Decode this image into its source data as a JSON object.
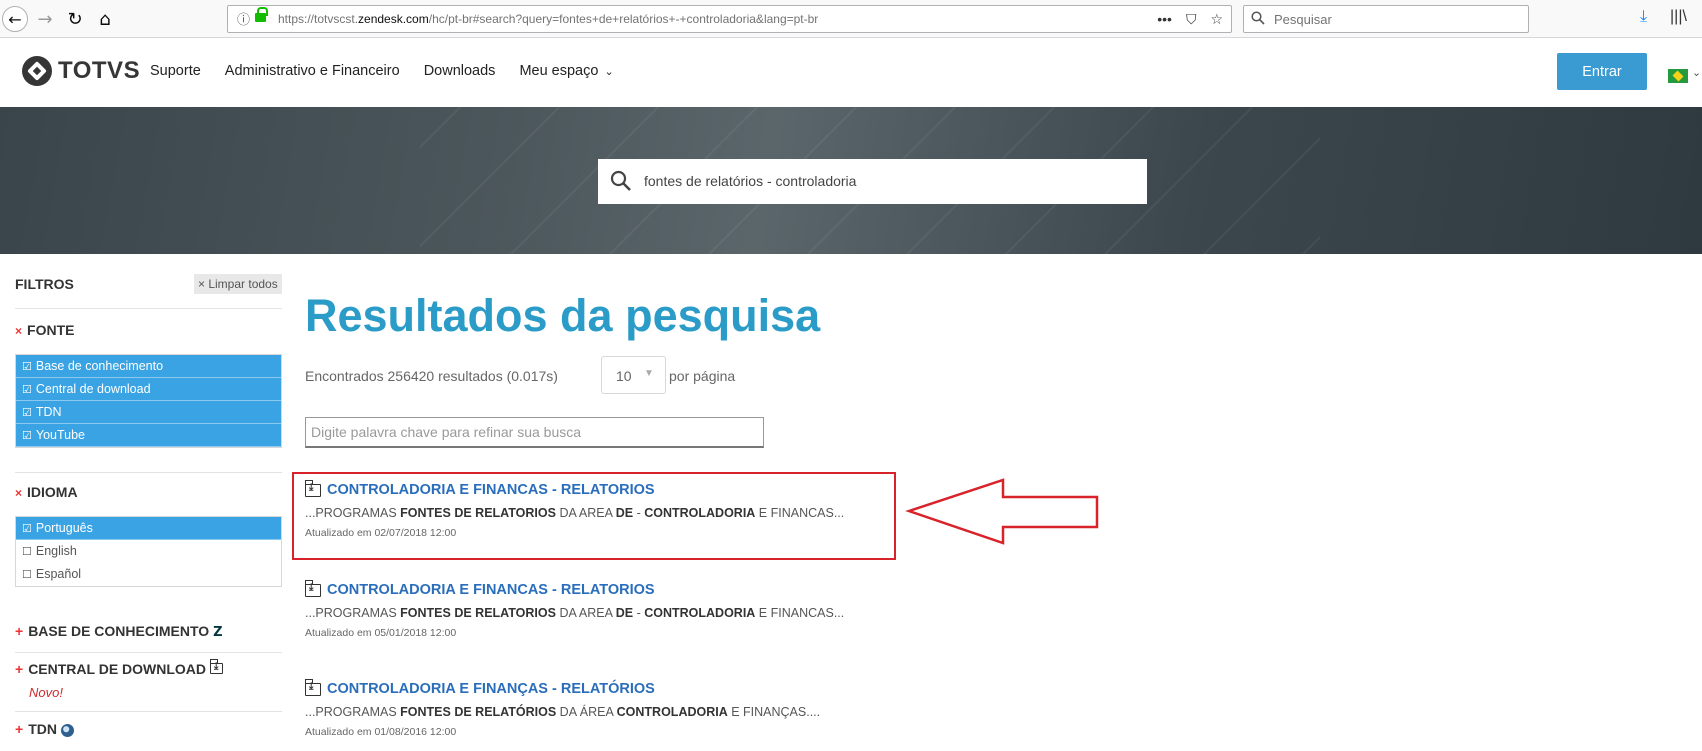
{
  "browser": {
    "url_prefix": "https://totvscst.",
    "url_domain": "zendesk.com",
    "url_suffix": "/hc/pt-br#search?query=fontes+de+relatórios+-+controladoria&lang=pt-br",
    "search_placeholder": "Pesquisar"
  },
  "header": {
    "logo_text": "TOTVS",
    "nav": [
      "Suporte",
      "Administrativo e Financeiro",
      "Downloads",
      "Meu espaço"
    ],
    "login_label": "Entrar"
  },
  "hero": {
    "query": "fontes de relatórios - controladoria"
  },
  "sidebar": {
    "title": "FILTROS",
    "clear_all": "× Limpar todos",
    "fonte": {
      "title": "FONTE",
      "items": [
        "Base de conhecimento",
        "Central de download",
        "TDN",
        "YouTube"
      ]
    },
    "idioma": {
      "title": "IDIOMA",
      "items": [
        "Português",
        "English",
        "Español"
      ]
    },
    "collapsed": [
      "BASE DE CONHECIMENTO",
      "CENTRAL DE DOWNLOAD",
      "TDN"
    ],
    "novo": "Novo!"
  },
  "main": {
    "title": "Resultados da pesquisa",
    "count": "Encontrados 256420 resultados (0.017s)",
    "per_page_value": "10",
    "per_page_label": "por página",
    "refine_placeholder": "Digite palavra chave para refinar sua busca",
    "results": [
      {
        "title": "CONTROLADORIA E FINANCAS - RELATORIOS",
        "snippet": [
          "...PROGRAMAS ",
          "FONTES DE RELATORIOS",
          " DA AREA ",
          "DE",
          " - ",
          "CONTROLADORIA",
          " E FINANCAS..."
        ],
        "date": "Atualizado em 02/07/2018 12:00"
      },
      {
        "title": "CONTROLADORIA E FINANCAS - RELATORIOS",
        "snippet": [
          "...PROGRAMAS ",
          "FONTES DE RELATORIOS",
          " DA AREA ",
          "DE",
          " - ",
          "CONTROLADORIA",
          " E FINANCAS..."
        ],
        "date": "Atualizado em 05/01/2018 12:00"
      },
      {
        "title": "CONTROLADORIA E FINANÇAS - RELATÓRIOS",
        "snippet": [
          "...PROGRAMAS ",
          "FONTES DE RELATÓRIOS",
          " DA ÁREA ",
          "",
          "",
          "CONTROLADORIA",
          " E FINANÇAS...."
        ],
        "date": "Atualizado em 01/08/2016 12:00"
      }
    ]
  },
  "colors": {
    "accent": "#3aa3e3",
    "title": "#2b9cc8",
    "link": "#2a6ebb",
    "annotation": "#d8232a"
  }
}
